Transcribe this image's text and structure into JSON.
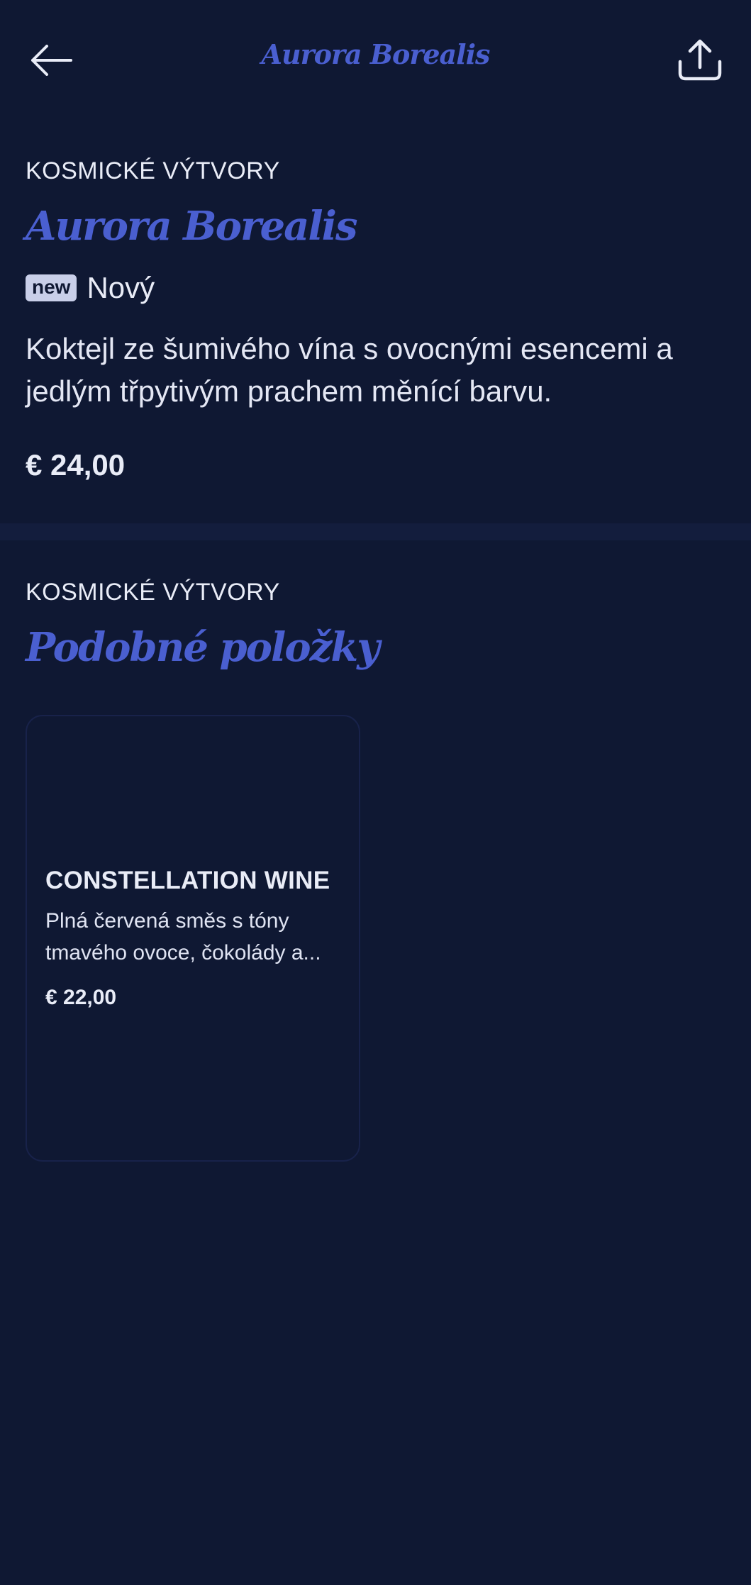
{
  "header": {
    "title": "Aurora Borealis",
    "back_icon": "arrow-left-icon",
    "share_icon": "share-icon"
  },
  "product": {
    "category": "KOSMICKÉ VÝTVORY",
    "name": "Aurora Borealis",
    "badge": "new",
    "badge_label": "Nový",
    "description_lines": [
      "Koktejl ze šumivého vína s ovocnými esencemi a",
      "jedlým třpytivým prachem měnící barvu."
    ],
    "price": "€ 24,00"
  },
  "similar": {
    "category": "KOSMICKÉ VÝTVORY",
    "heading": "Podobné položky",
    "items": [
      {
        "name": "CONSTELLATION WINE",
        "description_lines": [
          "Plná červená směs s tóny",
          "tmavého ovoce, čokolády a..."
        ],
        "price": "€ 22,00"
      }
    ]
  },
  "colors": {
    "background": "#0f1833",
    "accent": "#4a5fd0",
    "text": "#e9ecf7",
    "badge_bg": "#c9cfe9"
  }
}
